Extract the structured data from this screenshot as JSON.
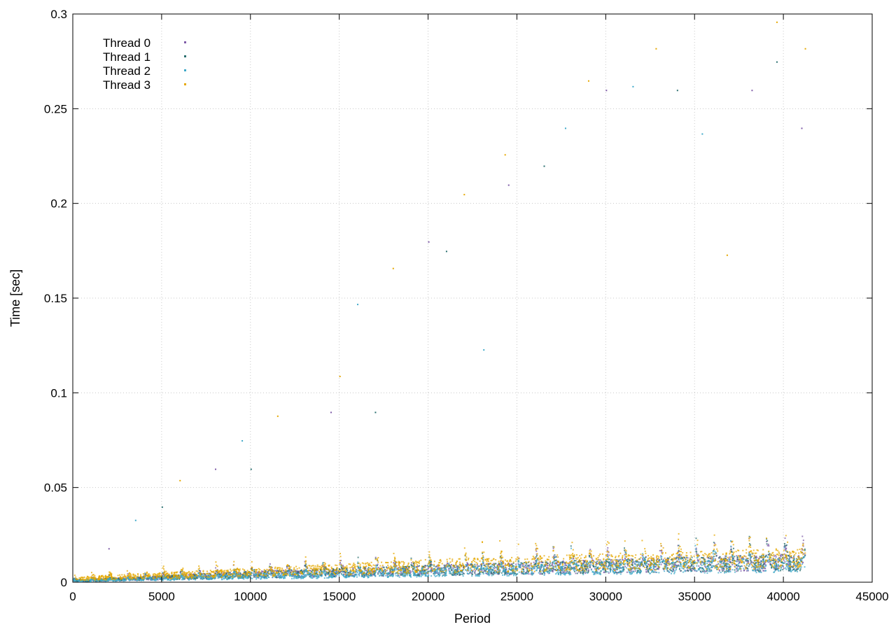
{
  "chart_data": {
    "type": "scatter",
    "xlabel": "Period",
    "ylabel": "Time [sec]",
    "xlim": [
      0,
      45000
    ],
    "ylim": [
      0,
      0.3
    ],
    "x_ticks": [
      0,
      5000,
      10000,
      15000,
      20000,
      25000,
      30000,
      35000,
      40000,
      45000
    ],
    "y_ticks": [
      0,
      0.05,
      0.1,
      0.15,
      0.2,
      0.25,
      0.3
    ],
    "x_tick_labels": [
      "0",
      "5000",
      "10000",
      "15000",
      "20000",
      "25000",
      "30000",
      "35000",
      "40000",
      "45000"
    ],
    "y_tick_labels": [
      "0",
      "0.05",
      "0.1",
      "0.15",
      "0.2",
      "0.25",
      "0.3"
    ],
    "grid": true,
    "legend_position": "top-left",
    "series": [
      {
        "name": "Thread 0",
        "color": "#7f5ca8",
        "baseline_trend": [
          [
            0,
            0.001
          ],
          [
            10000,
            0.004
          ],
          [
            20000,
            0.006
          ],
          [
            30000,
            0.008
          ],
          [
            41200,
            0.01
          ]
        ],
        "outliers": [
          [
            2000,
            0.018
          ],
          [
            8000,
            0.06
          ],
          [
            14500,
            0.09
          ],
          [
            20000,
            0.18
          ],
          [
            24500,
            0.21
          ],
          [
            30000,
            0.26
          ],
          [
            38200,
            0.26
          ],
          [
            41000,
            0.24
          ]
        ]
      },
      {
        "name": "Thread 1",
        "color": "#2a6f6f",
        "baseline_trend": [
          [
            0,
            0.001
          ],
          [
            10000,
            0.004
          ],
          [
            20000,
            0.006
          ],
          [
            30000,
            0.008
          ],
          [
            41200,
            0.01
          ]
        ],
        "outliers": [
          [
            5000,
            0.04
          ],
          [
            10000,
            0.06
          ],
          [
            17000,
            0.09
          ],
          [
            21000,
            0.175
          ],
          [
            26500,
            0.22
          ],
          [
            34000,
            0.26
          ],
          [
            39600,
            0.275
          ]
        ]
      },
      {
        "name": "Thread 2",
        "color": "#3fa9c9",
        "baseline_trend": [
          [
            0,
            0.001
          ],
          [
            10000,
            0.003
          ],
          [
            20000,
            0.005
          ],
          [
            30000,
            0.007
          ],
          [
            41200,
            0.009
          ]
        ],
        "outliers": [
          [
            3500,
            0.033
          ],
          [
            9500,
            0.075
          ],
          [
            16000,
            0.147
          ],
          [
            23100,
            0.123
          ],
          [
            27700,
            0.24
          ],
          [
            31500,
            0.262
          ],
          [
            35400,
            0.237
          ]
        ]
      },
      {
        "name": "Thread 3",
        "color": "#e6a800",
        "baseline_trend": [
          [
            0,
            0.002
          ],
          [
            10000,
            0.005
          ],
          [
            20000,
            0.008
          ],
          [
            30000,
            0.01
          ],
          [
            41200,
            0.012
          ]
        ],
        "outliers": [
          [
            6000,
            0.054
          ],
          [
            11500,
            0.088
          ],
          [
            15000,
            0.109
          ],
          [
            18000,
            0.166
          ],
          [
            22000,
            0.205
          ],
          [
            24300,
            0.226
          ],
          [
            29000,
            0.265
          ],
          [
            32800,
            0.282
          ],
          [
            36800,
            0.173
          ],
          [
            39600,
            0.296
          ],
          [
            41200,
            0.282
          ]
        ]
      }
    ],
    "max_period": 41200
  }
}
